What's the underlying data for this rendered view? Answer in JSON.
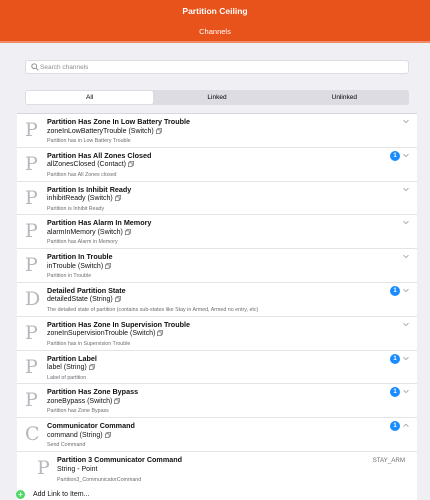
{
  "header": {
    "title": "Partition Ceiling",
    "subtitle": "Channels"
  },
  "search": {
    "placeholder": "Search channels"
  },
  "segments": [
    "All",
    "Linked",
    "Unlinked"
  ],
  "channels": [
    {
      "letter": "P",
      "name": "Partition Has Zone In Low Battery Trouble",
      "type": "zoneInLowBatteryTrouble (Switch)",
      "desc": "Partition has in Low Battery Trouble",
      "badge": "",
      "expanded": false
    },
    {
      "letter": "P",
      "name": "Partition Has All Zones Closed",
      "type": "allZonesClosed (Contact)",
      "desc": "Partition has All Zones closed",
      "badge": "1",
      "expanded": false
    },
    {
      "letter": "P",
      "name": "Partition Is Inhibit Ready",
      "type": "inhibitReady (Switch)",
      "desc": "Partition is Inhibit Ready",
      "badge": "",
      "expanded": false
    },
    {
      "letter": "P",
      "name": "Partition Has Alarm In Memory",
      "type": "alarmInMemory (Switch)",
      "desc": "Partition has Alarm in Memory",
      "badge": "",
      "expanded": false
    },
    {
      "letter": "P",
      "name": "Partition In Trouble",
      "type": "inTrouble (Switch)",
      "desc": "Partition in Trouble",
      "badge": "",
      "expanded": false
    },
    {
      "letter": "D",
      "name": "Detailed Partition State",
      "type": "detailedState (String)",
      "desc": "The detailed state of partition (contains sub-states like Stay in Armed, Armed no entry, etc)",
      "badge": "1",
      "expanded": false
    },
    {
      "letter": "P",
      "name": "Partition Has Zone In Supervision Trouble",
      "type": "zoneInSupervisionTrouble (Switch)",
      "desc": "Partition has in Supervision Trouble",
      "badge": "",
      "expanded": false
    },
    {
      "letter": "P",
      "name": "Partition Label",
      "type": "label (String)",
      "desc": "Label of partition",
      "badge": "1",
      "expanded": false
    },
    {
      "letter": "P",
      "name": "Partition Has Zone Bypass",
      "type": "zoneBypass (Switch)",
      "desc": "Partition has Zone Bypass",
      "badge": "1",
      "expanded": false
    },
    {
      "letter": "C",
      "name": "Communicator Command",
      "type": "command (String)",
      "desc": "Send Command",
      "badge": "1",
      "expanded": true
    }
  ],
  "linked_item": {
    "letter": "P",
    "name": "Partition 3 Communicator Command",
    "type": "String - Point",
    "desc": "Partition3_CommunicatorCommand",
    "state": "STAY_ARM"
  },
  "add_link": {
    "label": "Add Link to Item..."
  }
}
